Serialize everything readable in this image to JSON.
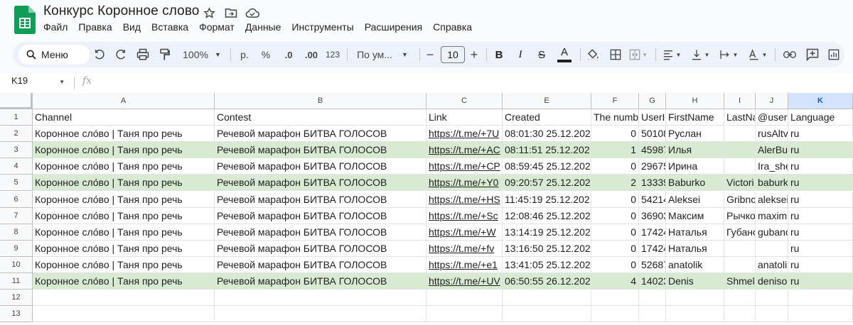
{
  "doc": {
    "title": "Конкурс Коронное слово"
  },
  "menu": [
    "Файл",
    "Правка",
    "Вид",
    "Вставка",
    "Формат",
    "Данные",
    "Инструменты",
    "Расширения",
    "Справка"
  ],
  "toolbar": {
    "search_label": "Меню",
    "zoom": "100%",
    "currency": "р.",
    "percent": "%",
    "decimal_decrease": ".0",
    "decimal_increase": ".00",
    "number_format": "123",
    "font_name": "По ум...",
    "font_size": "10",
    "minus": "−",
    "plus": "+",
    "bold": "B",
    "italic": "I",
    "strike": "S",
    "text_color": "A",
    "text_color_bar": "#1f1f1f"
  },
  "formula_bar": {
    "cell_ref": "K19",
    "fx": "fx",
    "value": ""
  },
  "grid": {
    "columns": [
      "A",
      "B",
      "C",
      "E",
      "F",
      "G",
      "H",
      "I",
      "J",
      "K"
    ],
    "selected_column": "K",
    "row_numbers": [
      "1",
      "2",
      "3",
      "4",
      "5",
      "6",
      "7",
      "8",
      "9",
      "10",
      "11",
      "12",
      "13"
    ],
    "highlight_color": "#d9ead3",
    "highlighted_rows": [
      3,
      5,
      11
    ],
    "header_row": [
      "Channel",
      "Contest",
      "Link",
      "Created",
      "The numb",
      "UserI",
      "FirstName",
      "LastNa",
      "@user",
      "Language"
    ],
    "rows": [
      [
        "Коронное сло́во | Таня про речь",
        "Речевой марафон БИТВА ГОЛОСОВ",
        "https://t.me/+7U",
        "08:01:30 25.12.202",
        "0",
        "50108",
        "Руслан",
        "",
        "rusAltv",
        "ru"
      ],
      [
        "Коронное сло́во | Таня про речь",
        "Речевой марафон БИТВА ГОЛОСОВ",
        "https://t.me/+AC",
        "08:11:51 25.12.202",
        "1",
        "45987",
        "Илья",
        "",
        "AlerBu",
        "ru"
      ],
      [
        "Коронное сло́во | Таня про речь",
        "Речевой марафон БИТВА ГОЛОСОВ",
        "https://t.me/+CP",
        "08:59:45 25.12.202",
        "0",
        "29675",
        "Ирина",
        "",
        "Ira_she",
        "ru"
      ],
      [
        "Коронное сло́во | Таня про речь",
        "Речевой марафон БИТВА ГОЛОСОВ",
        "https://t.me/+Y0",
        "09:20:57 25.12.202",
        "2",
        "13339",
        "Baburko",
        "Victori",
        "baburk",
        "ru"
      ],
      [
        "Коронное сло́во | Таня про речь",
        "Речевой марафон БИТВА ГОЛОСОВ",
        "https://t.me/+HS",
        "11:45:19 25.12.202",
        "0",
        "54214",
        "Aleksei",
        "Gribnc",
        "aleksei",
        "ru"
      ],
      [
        "Коронное сло́во | Таня про речь",
        "Речевой марафон БИТВА ГОЛОСОВ",
        "https://t.me/+Sc",
        "12:08:46 25.12.202",
        "0",
        "36903",
        "Максим",
        "Рычко",
        "maxim",
        "ru"
      ],
      [
        "Коронное сло́во | Таня про речь",
        "Речевой марафон БИТВА ГОЛОСОВ",
        "https://t.me/+W",
        "13:14:19 25.12.202",
        "0",
        "17424",
        "Наталья",
        "Губанс",
        "gubanс",
        "ru"
      ],
      [
        "Коронное сло́во | Таня про речь",
        "Речевой марафон БИТВА ГОЛОСОВ",
        "https://t.me/+fv",
        "13:16:50 25.12.202",
        "0",
        "17424",
        "Наталья",
        "",
        "",
        "ru"
      ],
      [
        "Коронное сло́во | Таня про речь",
        "Речевой марафон БИТВА ГОЛОСОВ",
        "https://t.me/+e1",
        "13:41:05 25.12.202",
        "0",
        "52687",
        "anatolik",
        "",
        "anatoli",
        "ru"
      ],
      [
        "Коронное сло́во | Таня про речь",
        "Речевой марафон БИТВА ГОЛОСОВ",
        "https://t.me/+UV",
        "06:50:55 26.12.202",
        "4",
        "14023",
        "Denis",
        "Shmelc",
        "deniso",
        "ru"
      ]
    ]
  }
}
